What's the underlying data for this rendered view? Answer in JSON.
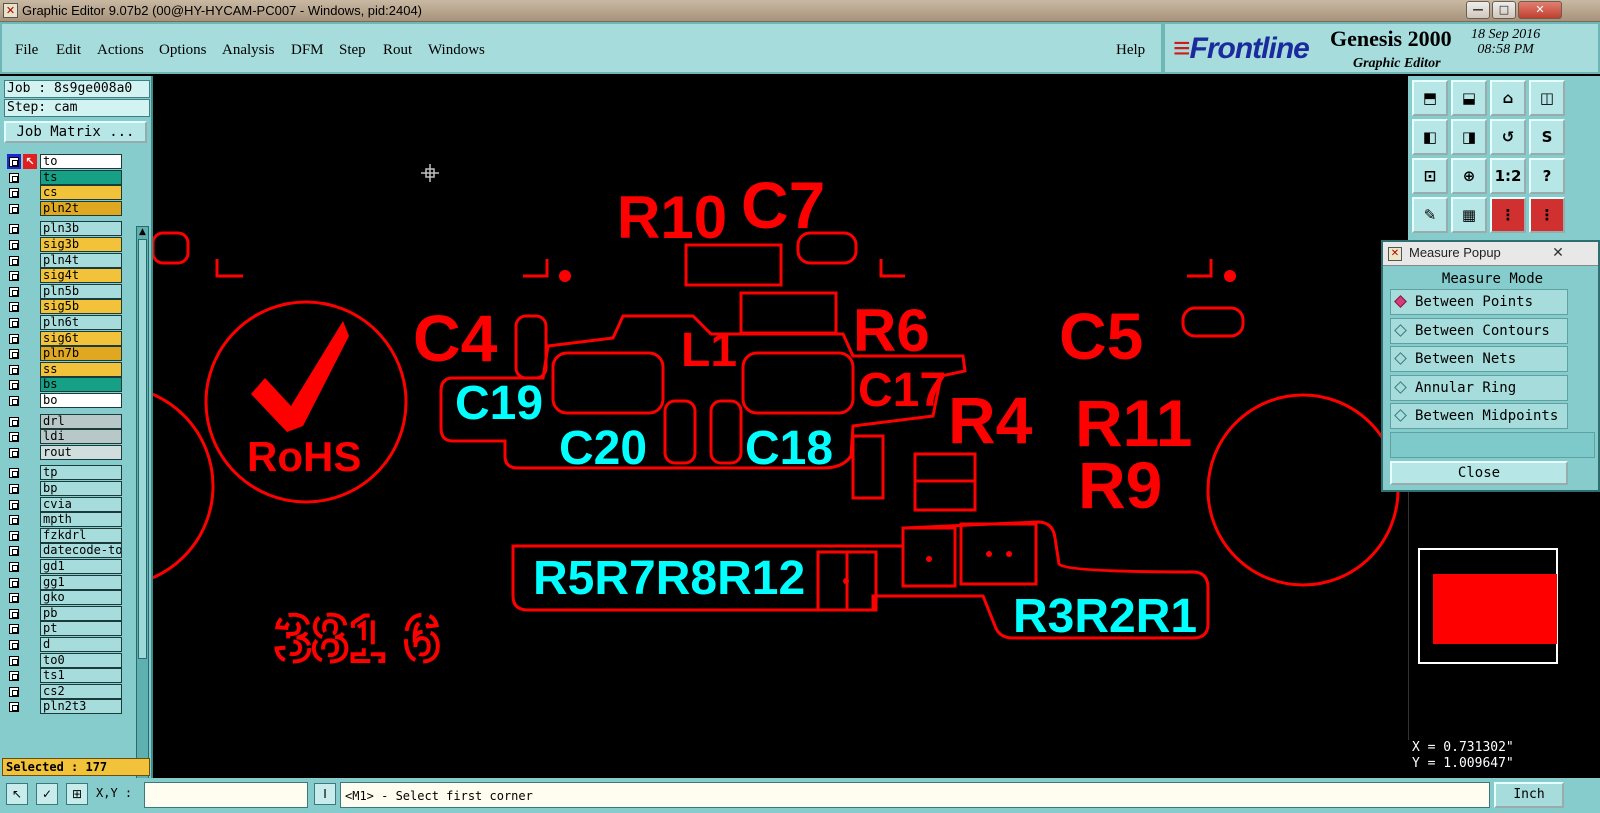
{
  "window": {
    "title": "Graphic Editor 9.07b2 (00@HY-HYCAM-PC007 - Windows, pid:2404)",
    "min_glyph": "—",
    "max_glyph": "□",
    "close_glyph": "✕"
  },
  "menu": {
    "items": [
      {
        "label": "File"
      },
      {
        "label": "Edit"
      },
      {
        "label": "Actions"
      },
      {
        "label": "Options"
      },
      {
        "label": "Analysis"
      },
      {
        "label": "DFM"
      },
      {
        "label": "Step"
      },
      {
        "label": "Rout"
      },
      {
        "label": "Windows"
      }
    ],
    "help": "Help"
  },
  "brand": {
    "logo": "Frontline",
    "product": "Genesis 2000",
    "subtitle": "Graphic Editor",
    "date": "18 Sep 2016",
    "time": "08:58 PM"
  },
  "left_panel": {
    "job": "Job : 8s9ge008a0",
    "step": "Step: cam",
    "job_matrix": "Job Matrix ...",
    "selected": "Selected : 177"
  },
  "layers": [
    {
      "name": "to",
      "color": "#ffffff",
      "mark": "✎≡"
    },
    {
      "name": "ts",
      "color": "#16a085",
      "mark": ""
    },
    {
      "name": "cs",
      "color": "#f2c23a",
      "mark": "✎"
    },
    {
      "name": "pln2t",
      "color": "#e0a820",
      "mark": ""
    },
    {
      "name": "pln3b",
      "color": "#a6dcdc",
      "mark": ""
    },
    {
      "name": "sig3b",
      "color": "#f2c23a",
      "mark": ""
    },
    {
      "name": "pln4t",
      "color": "#a6dcdc",
      "mark": ""
    },
    {
      "name": "sig4t",
      "color": "#f2c23a",
      "mark": ""
    },
    {
      "name": "pln5b",
      "color": "#a6dcdc",
      "mark": ""
    },
    {
      "name": "sig5b",
      "color": "#f2c23a",
      "mark": ""
    },
    {
      "name": "pln6t",
      "color": "#a6dcdc",
      "mark": ""
    },
    {
      "name": "sig6t",
      "color": "#f2c23a",
      "mark": ""
    },
    {
      "name": "pln7b",
      "color": "#e0a820",
      "mark": ""
    },
    {
      "name": "ss",
      "color": "#f2c23a",
      "mark": "✎"
    },
    {
      "name": "bs",
      "color": "#16a085",
      "mark": ""
    },
    {
      "name": "bo",
      "color": "#ffffff",
      "mark": "✎"
    },
    {
      "name": "drl",
      "color": "#b8c8c8",
      "mark": ""
    },
    {
      "name": "ldi",
      "color": "#b8c8c8",
      "mark": ""
    },
    {
      "name": "rout",
      "color": "#d0dede",
      "mark": ""
    },
    {
      "name": "tp",
      "color": "#a6dcdc",
      "mark": ""
    },
    {
      "name": "bp",
      "color": "#a6dcdc",
      "mark": ""
    },
    {
      "name": "cvia",
      "color": "#a6dcdc",
      "mark": ""
    },
    {
      "name": "mpth",
      "color": "#a6dcdc",
      "mark": ""
    },
    {
      "name": "fzkdrl",
      "color": "#a6dcdc",
      "mark": ""
    },
    {
      "name": "datecode-to",
      "color": "#a6dcdc",
      "mark": ""
    },
    {
      "name": "gd1",
      "color": "#a6dcdc",
      "mark": "✎"
    },
    {
      "name": "gg1",
      "color": "#a6dcdc",
      "mark": ""
    },
    {
      "name": "gko",
      "color": "#a6dcdc",
      "mark": "✎"
    },
    {
      "name": "pb",
      "color": "#a6dcdc",
      "mark": ""
    },
    {
      "name": "pt",
      "color": "#a6dcdc",
      "mark": ""
    },
    {
      "name": "d",
      "color": "#a6dcdc",
      "mark": ""
    },
    {
      "name": "to0",
      "color": "#a6dcdc",
      "mark": ""
    },
    {
      "name": "ts1",
      "color": "#a6dcdc",
      "mark": ""
    },
    {
      "name": "cs2",
      "color": "#a6dcdc",
      "mark": ""
    },
    {
      "name": "pln2t3",
      "color": "#a6dcdc",
      "mark": ""
    }
  ],
  "canvas": {
    "red_labels": [
      "R10",
      "C7",
      "C4",
      "L1",
      "R6",
      "C5",
      "C17",
      "R4",
      "R11",
      "R9",
      "RoHS",
      "381 6"
    ],
    "cyan_labels": [
      "C19",
      "C20",
      "C18",
      "R5R7R8R12",
      "R3R2R1"
    ]
  },
  "measure_popup": {
    "title": "Measure Popup",
    "heading": "Measure Mode",
    "modes": [
      {
        "label": "Between Points",
        "active": true
      },
      {
        "label": "Between Contours",
        "active": false
      },
      {
        "label": "Between Nets",
        "active": false
      },
      {
        "label": "Annular Ring",
        "active": false
      },
      {
        "label": "Between Midpoints",
        "active": false
      }
    ],
    "close": "Close"
  },
  "coords": {
    "x": "X = 0.731302\"",
    "y": "Y = 1.009647\""
  },
  "statusbar": {
    "xy_label": "X,Y :",
    "prompt": "<M1> - Select first corner",
    "units": "Inch"
  },
  "colors": {
    "red": "#ff0000",
    "cyan": "#00ffff",
    "panel": "#86cccc"
  }
}
